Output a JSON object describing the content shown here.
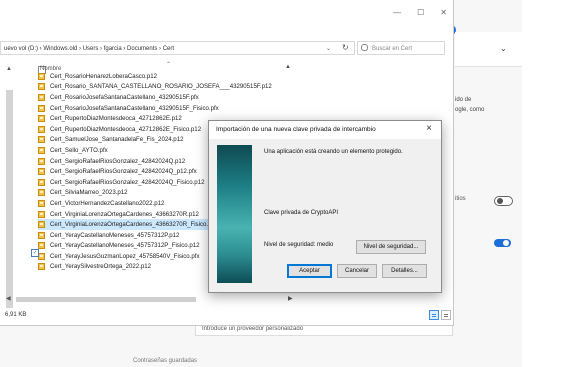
{
  "background": {
    "text_partial_1": "ido de",
    "text_partial_2": "ogle, como",
    "text_partial_3": "itios",
    "provider_text": "Introduce un proveedor personalizado",
    "bottom_text": "Contraseñas guardadas"
  },
  "explorer": {
    "window_controls": [
      "—",
      "☐",
      "✕"
    ],
    "address": "uevo vol (D:)  ›  Windows.old  ›  Users  ›  fgarcia  ›  Documents  ›  Cert",
    "search_placeholder": "Buscar en Cert",
    "column_name": "Nombre",
    "files": [
      {
        "name": "Cert_RosarioHenarezLoberaCasco.p12",
        "selected": false
      },
      {
        "name": "Cert_Rosario_SANTANA_CASTELLANO_ROSARIO_JOSEFA___43290515F.p12",
        "selected": false
      },
      {
        "name": "Cert_RosarioJosefaSantanaCastellano_43290515F.pfx",
        "selected": false
      },
      {
        "name": "Cert_RosarioJosefaSantanaCastellano_43290515F_Fisico.pfx",
        "selected": false
      },
      {
        "name": "Cert_RupertoDiazMontesdeoca_42712862E.p12",
        "selected": false
      },
      {
        "name": "Cert_RupertoDiazMontesdeoca_42712862E_Fisico.p12",
        "selected": false
      },
      {
        "name": "Cert_SamuelJose_SantanadelaFe_Fis_2024.p12",
        "selected": false
      },
      {
        "name": "Cert_Sello_AYTO.pfx",
        "selected": false
      },
      {
        "name": "Cert_SergioRafaelRiosGonzalez_42842024Q.p12",
        "selected": false
      },
      {
        "name": "Cert_SergioRafaelRiosGonzalez_42842024Q_p12.pfx",
        "selected": false
      },
      {
        "name": "Cert_SergioRafaelRiosGonzalez_42842024Q_Fisico.p12",
        "selected": false
      },
      {
        "name": "Cert_SilviaMarreo_2023.p12",
        "selected": false
      },
      {
        "name": "Cert_VictorHernandezCastellano2022.p12",
        "selected": false
      },
      {
        "name": "Cert_VirginiaLorenzaOrtegaCardenes_43663270R.p12",
        "selected": false
      },
      {
        "name": "Cert_VirginiaLorenzaOrtegaCardenes_43663270R_Fisico.p12",
        "selected": true
      },
      {
        "name": "Cert_YerayCastellanoMeneses_45757312P.p12",
        "selected": false
      },
      {
        "name": "Cert_YerayCastellanoMeneses_45757312P_Fisico.p12",
        "selected": false
      },
      {
        "name": "Cert_YerayJesusGuzmanLopez_45758540V_Fisico.pfx",
        "selected": false
      },
      {
        "name": "Cert_YeraySilvestreOrtega_2022.p12",
        "selected": false
      }
    ],
    "status": "6,91 KB"
  },
  "dialog": {
    "title": "Importación de una nueva clave privada de intercambio",
    "message": "Una aplicación está creando un elemento protegido.",
    "key_label": "Clave privada de CryptoAPI",
    "security_label": "Nivel de seguridad: medio",
    "level_button": "Nivel de seguridad...",
    "accept_button": "Aceptar",
    "cancel_button": "Cancelar",
    "details_button": "Detalles..."
  },
  "colors": {
    "accent": "#1c6fd8",
    "selection": "#cce8ff",
    "dialog_bg": "#f0f0f0"
  }
}
